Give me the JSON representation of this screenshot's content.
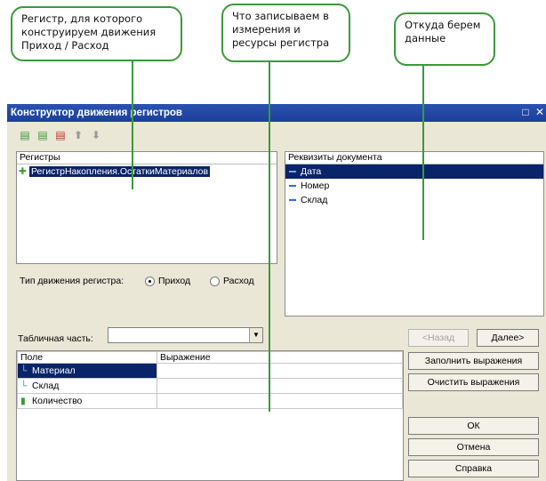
{
  "callouts": [
    {
      "lines": [
        "Регистр, для которого",
        "конструируем движения",
        "Приход / Расход"
      ]
    },
    {
      "lines": [
        "Что записываем в",
        "измерения и",
        "ресурсы регистра"
      ]
    },
    {
      "lines": [
        "Откуда берем",
        "данные"
      ]
    }
  ],
  "window": {
    "title": "Конструктор движения регистров",
    "maximize_icon": "□",
    "close_icon": "✕"
  },
  "toolbar": [
    "add-register-icon",
    "add-copy-icon",
    "delete-icon",
    "move-up-icon",
    "move-down-icon"
  ],
  "registers": {
    "header": "Регистры",
    "items": [
      {
        "label": "РегистрНакопления.ОстаткиМатериалов",
        "selected": true
      }
    ]
  },
  "doc_attrs": {
    "header": "Реквизиты документа",
    "items": [
      {
        "label": "Дата",
        "selected": true
      },
      {
        "label": "Номер",
        "selected": false
      },
      {
        "label": "Склад",
        "selected": false
      }
    ]
  },
  "movement_type": {
    "label": "Тип движения регистра:",
    "options": [
      {
        "label": "Приход",
        "checked": true
      },
      {
        "label": "Расход",
        "checked": false
      }
    ]
  },
  "table_part": {
    "label": "Табличная часть:",
    "value": ""
  },
  "nav": {
    "back": "<Назад",
    "next": "Далее>"
  },
  "fields": {
    "col_field": "Поле",
    "col_expr": "Выражение",
    "rows": [
      {
        "field": "Материал",
        "expr": "",
        "icon": "dimension-icon",
        "selected": true
      },
      {
        "field": "Склад",
        "expr": "",
        "icon": "dimension-icon",
        "selected": false
      },
      {
        "field": "Количество",
        "expr": "",
        "icon": "resource-icon",
        "selected": false
      }
    ]
  },
  "actions": {
    "fill": "Заполнить выражения",
    "clear": "Очистить выражения",
    "ok": "ОК",
    "cancel": "Отмена",
    "help": "Справка"
  }
}
